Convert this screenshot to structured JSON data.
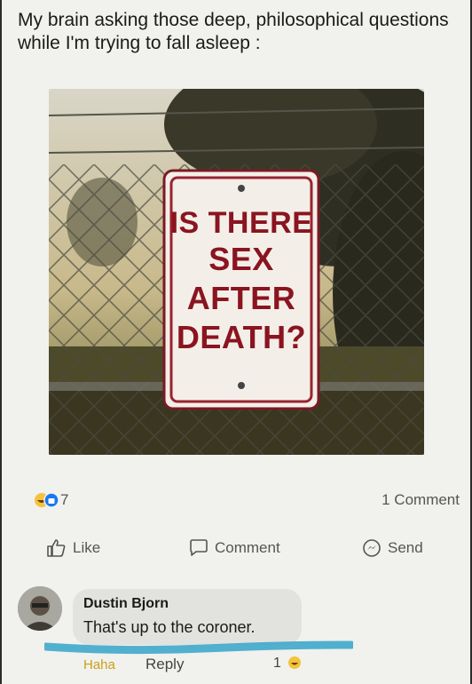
{
  "meme": {
    "caption": "My brain asking those deep, philosophical questions while I'm trying to fall asleep :"
  },
  "sign": {
    "line1": "IS THERE",
    "line2": "SEX",
    "line3": "AFTER",
    "line4": "DEATH?",
    "text_color": "#8a1420",
    "border_color": "#7a1a24"
  },
  "post": {
    "reaction_count": "7",
    "comment_count": "1 Comment",
    "reactions": [
      "haha-icon",
      "like-icon"
    ]
  },
  "actions": {
    "like_label": "Like",
    "comment_label": "Comment",
    "send_label": "Send"
  },
  "comment": {
    "author": "Dustin Bjorn",
    "text": "That's up to the coroner.",
    "haha_label": "Haha",
    "reply_label": "Reply",
    "reaction_count": "1",
    "reaction_icon": "haha-icon"
  },
  "colors": {
    "highlight_underline": "#3fa9c9",
    "haha_yellow": "#f5c33b",
    "like_blue": "#1877f2"
  }
}
